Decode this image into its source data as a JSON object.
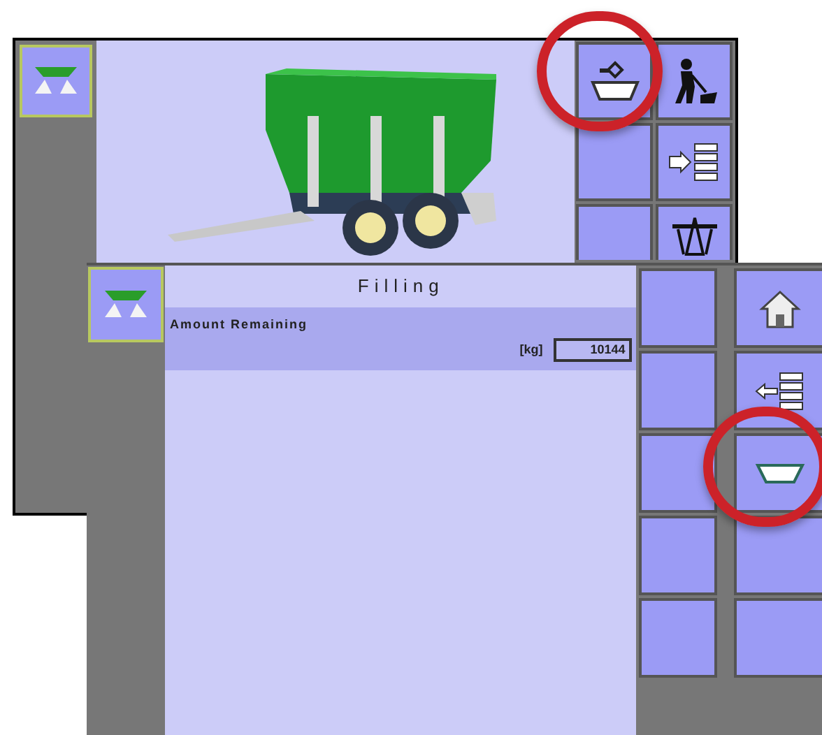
{
  "front_screen": {
    "title": "Filling",
    "field": {
      "label": "Amount Remaining",
      "unit": "[kg]",
      "value": "10144"
    }
  }
}
